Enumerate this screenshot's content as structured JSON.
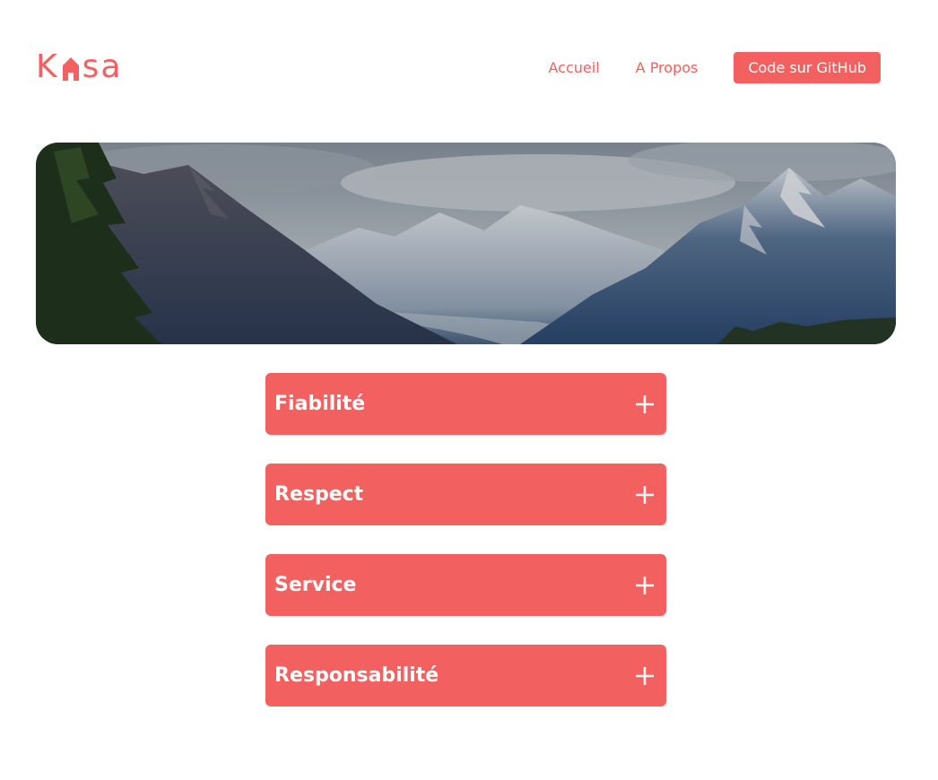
{
  "header": {
    "logo": {
      "text_before": "K",
      "text_after": "sa",
      "icon": "house-icon"
    },
    "nav": {
      "home_label": "Accueil",
      "about_label": "A Propos",
      "github_label": "Code sur GitHub"
    }
  },
  "banner": {
    "image": "mountain-landscape"
  },
  "collapses": [
    {
      "title": "Fiabilité",
      "icon": "plus-icon"
    },
    {
      "title": "Respect",
      "icon": "plus-icon"
    },
    {
      "title": "Service",
      "icon": "plus-icon"
    },
    {
      "title": "Responsabilité",
      "icon": "plus-icon"
    }
  ],
  "colors": {
    "accent": "#f26160",
    "text_on_accent": "#ffffff",
    "background": "#ffffff"
  }
}
